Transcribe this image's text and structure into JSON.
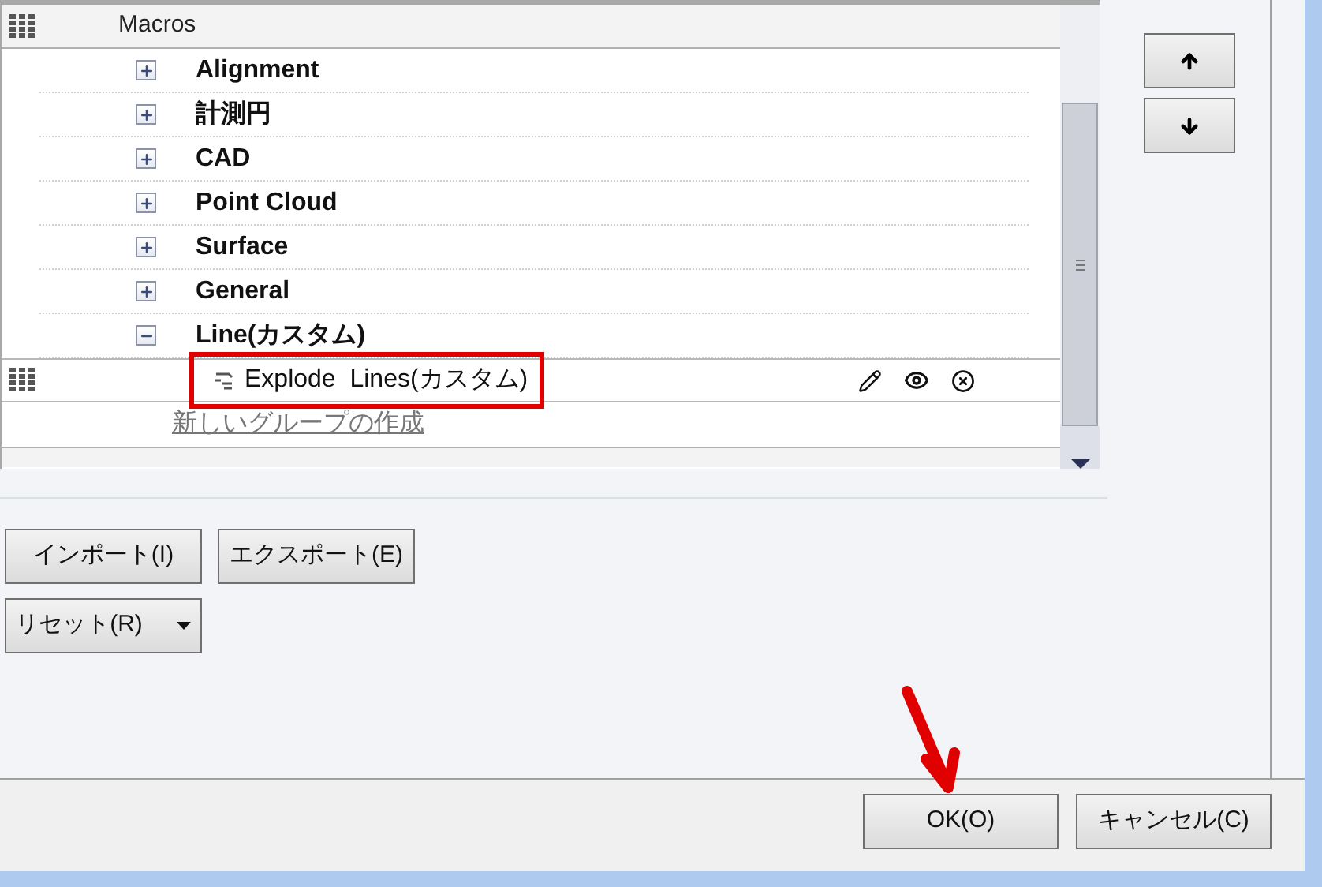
{
  "tree": {
    "groups": [
      {
        "label": "Macros",
        "new_group_link": "新しいグループの作成",
        "categories": [
          {
            "label": "Alignment",
            "expanded": false
          },
          {
            "label": "計測円",
            "expanded": false
          },
          {
            "label": "CAD",
            "expanded": false
          },
          {
            "label": "Point Cloud",
            "expanded": false
          },
          {
            "label": "Surface",
            "expanded": false
          },
          {
            "label": "General",
            "expanded": false
          },
          {
            "label": "Line(カスタム)",
            "expanded": true,
            "children": [
              {
                "label": "Explode  Lines(カスタム)",
                "highlighted": true
              }
            ]
          }
        ]
      }
    ]
  },
  "side_buttons": [
    {
      "kind": "up"
    },
    {
      "kind": "down"
    }
  ],
  "buttons": [
    {
      "label": "インポート(I)",
      "kind": "plain"
    },
    {
      "label": "エクスポート(E)",
      "kind": "plain"
    },
    {
      "label": "リセット(R)",
      "kind": "dropdown"
    }
  ],
  "dialog_buttons": [
    "OK(O)",
    "キャンセル(C)"
  ]
}
